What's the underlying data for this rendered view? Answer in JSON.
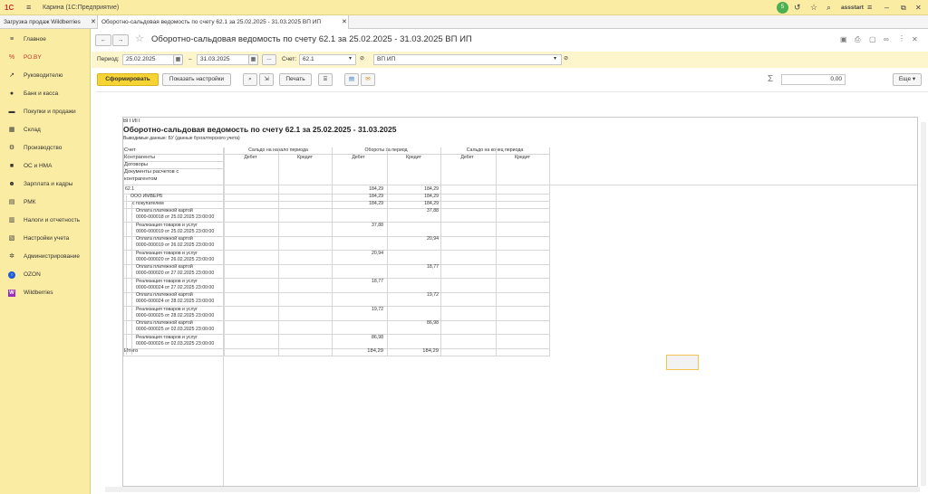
{
  "titlebar": {
    "logo": "1С",
    "app_title": "Карина  (1С:Предприятие)",
    "badge_count": "5",
    "user": "assstart"
  },
  "tabs": [
    {
      "label": "Загрузка продаж Wildberries"
    },
    {
      "label": "Оборотно-сальдовая ведомость по счету 62.1 за 25.02.2025 - 31.03.2025 ВП ИП"
    }
  ],
  "sidebar": {
    "items": [
      {
        "label": "Главное",
        "icon": "menu-icon"
      },
      {
        "label": "РО.BY",
        "icon": "percent-icon"
      },
      {
        "label": "Руководителю",
        "icon": "chart-icon"
      },
      {
        "label": "Банк и касса",
        "icon": "bank-icon"
      },
      {
        "label": "Покупки и продажи",
        "icon": "cart-icon"
      },
      {
        "label": "Склад",
        "icon": "warehouse-icon"
      },
      {
        "label": "Производство",
        "icon": "factory-icon"
      },
      {
        "label": "ОС и НМА",
        "icon": "truck-icon"
      },
      {
        "label": "Зарплата и кадры",
        "icon": "people-icon"
      },
      {
        "label": "РМК",
        "icon": "cashier-icon"
      },
      {
        "label": "Налоги и отчетность",
        "icon": "tax-icon"
      },
      {
        "label": "Настройки учета",
        "icon": "settings-doc-icon"
      },
      {
        "label": "Администрирование",
        "icon": "gear-icon"
      },
      {
        "label": "OZON",
        "icon": "ozon-icon"
      },
      {
        "label": "Wildberries",
        "icon": "wildberries-icon"
      }
    ]
  },
  "form": {
    "title": "Оборотно-сальдовая ведомость по счету 62.1 за 25.02.2025 - 31.03.2025 ВП ИП",
    "period_label": "Период:",
    "date_from": "25.02.2025",
    "date_dash": "–",
    "date_to": "31.03.2025",
    "dots": "...",
    "account_label": "Счет:",
    "account": "62.1",
    "org": "ВП ИП",
    "btn_generate": "Сформировать",
    "btn_settings": "Показать настройки",
    "btn_print": "Печать",
    "sigma": "Σ",
    "sum_value": "0,00",
    "more": "Еще"
  },
  "report": {
    "org": "ВП ИП",
    "title": "Оборотно-сальдовая ведомость по счету 62.1 за 25.02.2025 - 31.03.2025",
    "output": "Выводимые данные:  БУ (данные бухгалтерского учета)",
    "row_headers": [
      "Счет",
      "Контрагенты",
      "Договоры",
      "Документы расчетов с",
      "контрагентом"
    ],
    "groups": [
      "Сальдо на начало периода",
      "Обороты за период",
      "Сальдо на конец периода"
    ],
    "subcols": [
      "Дебет",
      "Кредит",
      "Дебет",
      "Кредит",
      "Дебет",
      "Кредит"
    ],
    "rows": [
      {
        "l1": "62.1",
        "l2": "",
        "d": "184,29",
        "c": "184,29"
      },
      {
        "l1": "ООО ИМВЕРБ",
        "l2": "",
        "d": "184,29",
        "c": "184,29"
      },
      {
        "l1": "с покупателем",
        "l2": "",
        "d": "184,29",
        "c": "184,29"
      },
      {
        "l1": "Оплата платежной картой",
        "l2": "0000-000018 от 25.02.2025 23:00:00",
        "d": "",
        "c": "37,88"
      },
      {
        "l1": "Реализация товаров и услуг",
        "l2": "0000-000019 от 25.02.2025 23:00:00",
        "d": "37,88",
        "c": ""
      },
      {
        "l1": "Оплата платежной картой",
        "l2": "0000-000019 от 26.02.2025 23:00:00",
        "d": "",
        "c": "20,94"
      },
      {
        "l1": "Реализация товаров и услуг",
        "l2": "0000-000020 от 26.02.2025 23:00:00",
        "d": "20,94",
        "c": ""
      },
      {
        "l1": "Оплата платежной картой",
        "l2": "0000-000020 от 27.02.2025 23:00:00",
        "d": "",
        "c": "18,77"
      },
      {
        "l1": "Реализация товаров и услуг",
        "l2": "0000-000024 от 27.02.2025 23:00:00",
        "d": "18,77",
        "c": ""
      },
      {
        "l1": "Оплата платежной картой",
        "l2": "0000-000024 от 28.02.2025 23:00:00",
        "d": "",
        "c": "19,72"
      },
      {
        "l1": "Реализация товаров и услуг",
        "l2": "0000-000025 от 28.02.2025 23:00:00",
        "d": "19,72",
        "c": ""
      },
      {
        "l1": "Оплата платежной картой",
        "l2": "0000-000025 от 02.03.2025 23:00:00",
        "d": "",
        "c": "86,98"
      },
      {
        "l1": "Реализация товаров и услуг",
        "l2": "0000-000026 от 02.03.2025 23:00:00",
        "d": "86,98",
        "c": ""
      }
    ],
    "total": {
      "label": "Итого",
      "d": "184,29",
      "c": "184,29"
    }
  },
  "colors": {
    "accent": "#fbeca4",
    "button_yellow": "#f7d334",
    "selection": "#f3c44d"
  }
}
